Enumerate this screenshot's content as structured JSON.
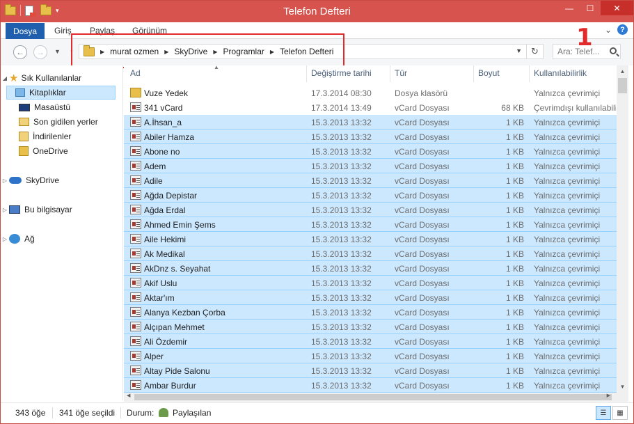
{
  "window": {
    "title": "Telefon Defteri"
  },
  "ribbon": {
    "file_tab": "Dosya",
    "tabs": [
      "Giriş",
      "Paylaş",
      "Görünüm"
    ]
  },
  "address": {
    "breadcrumbs": [
      "murat ozmen",
      "SkyDrive",
      "Programlar",
      "Telefon Defteri"
    ],
    "search_placeholder": "Ara: Telef..."
  },
  "annotation": {
    "number": "1"
  },
  "nav": {
    "favorites": "Sık Kullanılanlar",
    "items": [
      "Kitaplıklar",
      "Masaüstü",
      "Son gidilen yerler",
      "İndirilenler",
      "OneDrive"
    ],
    "skydrive": "SkyDrive",
    "computer": "Bu bilgisayar",
    "network": "Ağ"
  },
  "columns": [
    "Ad",
    "Değiştirme tarihi",
    "Tür",
    "Boyut",
    "Kullanılabilirlik"
  ],
  "files": [
    {
      "name": "Vuze Yedek",
      "date": "17.3.2014 08:30",
      "type": "Dosya klasörü",
      "size": "",
      "avail": "Yalnızca çevrimiçi",
      "kind": "folder",
      "selected": false
    },
    {
      "name": "341 vCard",
      "date": "17.3.2014 13:49",
      "type": "vCard Dosyası",
      "size": "68 KB",
      "avail": "Çevrimdışı kullanılabilir",
      "kind": "vcard",
      "selected": false
    },
    {
      "name": "A.İhsan_a",
      "date": "15.3.2013 13:32",
      "type": "vCard Dosyası",
      "size": "1 KB",
      "avail": "Yalnızca çevrimiçi",
      "kind": "vcard",
      "selected": true
    },
    {
      "name": "Abiler Hamza",
      "date": "15.3.2013 13:32",
      "type": "vCard Dosyası",
      "size": "1 KB",
      "avail": "Yalnızca çevrimiçi",
      "kind": "vcard",
      "selected": true
    },
    {
      "name": "Abone no",
      "date": "15.3.2013 13:32",
      "type": "vCard Dosyası",
      "size": "1 KB",
      "avail": "Yalnızca çevrimiçi",
      "kind": "vcard",
      "selected": true
    },
    {
      "name": "Adem",
      "date": "15.3.2013 13:32",
      "type": "vCard Dosyası",
      "size": "1 KB",
      "avail": "Yalnızca çevrimiçi",
      "kind": "vcard",
      "selected": true
    },
    {
      "name": "Adile",
      "date": "15.3.2013 13:32",
      "type": "vCard Dosyası",
      "size": "1 KB",
      "avail": "Yalnızca çevrimiçi",
      "kind": "vcard",
      "selected": true
    },
    {
      "name": "Ağda Depistar",
      "date": "15.3.2013 13:32",
      "type": "vCard Dosyası",
      "size": "1 KB",
      "avail": "Yalnızca çevrimiçi",
      "kind": "vcard",
      "selected": true
    },
    {
      "name": "Ağda Erdal",
      "date": "15.3.2013 13:32",
      "type": "vCard Dosyası",
      "size": "1 KB",
      "avail": "Yalnızca çevrimiçi",
      "kind": "vcard",
      "selected": true
    },
    {
      "name": "Ahmed Emin Şems",
      "date": "15.3.2013 13:32",
      "type": "vCard Dosyası",
      "size": "1 KB",
      "avail": "Yalnızca çevrimiçi",
      "kind": "vcard",
      "selected": true
    },
    {
      "name": "Aile Hekimi",
      "date": "15.3.2013 13:32",
      "type": "vCard Dosyası",
      "size": "1 KB",
      "avail": "Yalnızca çevrimiçi",
      "kind": "vcard",
      "selected": true
    },
    {
      "name": "Ak Medikal",
      "date": "15.3.2013 13:32",
      "type": "vCard Dosyası",
      "size": "1 KB",
      "avail": "Yalnızca çevrimiçi",
      "kind": "vcard",
      "selected": true
    },
    {
      "name": "AkDnz s. Seyahat",
      "date": "15.3.2013 13:32",
      "type": "vCard Dosyası",
      "size": "1 KB",
      "avail": "Yalnızca çevrimiçi",
      "kind": "vcard",
      "selected": true
    },
    {
      "name": "Akif Uslu",
      "date": "15.3.2013 13:32",
      "type": "vCard Dosyası",
      "size": "1 KB",
      "avail": "Yalnızca çevrimiçi",
      "kind": "vcard",
      "selected": true
    },
    {
      "name": "Aktar'ım",
      "date": "15.3.2013 13:32",
      "type": "vCard Dosyası",
      "size": "1 KB",
      "avail": "Yalnızca çevrimiçi",
      "kind": "vcard",
      "selected": true
    },
    {
      "name": "Alanya Kezban Çorba",
      "date": "15.3.2013 13:32",
      "type": "vCard Dosyası",
      "size": "1 KB",
      "avail": "Yalnızca çevrimiçi",
      "kind": "vcard",
      "selected": true
    },
    {
      "name": "Alçıpan Mehmet",
      "date": "15.3.2013 13:32",
      "type": "vCard Dosyası",
      "size": "1 KB",
      "avail": "Yalnızca çevrimiçi",
      "kind": "vcard",
      "selected": true
    },
    {
      "name": "Ali Özdemir",
      "date": "15.3.2013 13:32",
      "type": "vCard Dosyası",
      "size": "1 KB",
      "avail": "Yalnızca çevrimiçi",
      "kind": "vcard",
      "selected": true
    },
    {
      "name": "Alper",
      "date": "15.3.2013 13:32",
      "type": "vCard Dosyası",
      "size": "1 KB",
      "avail": "Yalnızca çevrimiçi",
      "kind": "vcard",
      "selected": true
    },
    {
      "name": "Altay Pide Salonu",
      "date": "15.3.2013 13:32",
      "type": "vCard Dosyası",
      "size": "1 KB",
      "avail": "Yalnızca çevrimiçi",
      "kind": "vcard",
      "selected": true
    },
    {
      "name": "Ambar Burdur",
      "date": "15.3.2013 13:32",
      "type": "vCard Dosyası",
      "size": "1 KB",
      "avail": "Yalnızca çevrimiçi",
      "kind": "vcard",
      "selected": true
    }
  ],
  "status": {
    "item_count": "343 öğe",
    "selected_count": "341 öğe seçildi",
    "state_label": "Durum:",
    "state_value": "Paylaşılan"
  },
  "colors": {
    "titlebar": "#d6534e",
    "file_tab": "#1f5fae",
    "selection": "#cce8ff",
    "annotation": "#e32a2a"
  }
}
